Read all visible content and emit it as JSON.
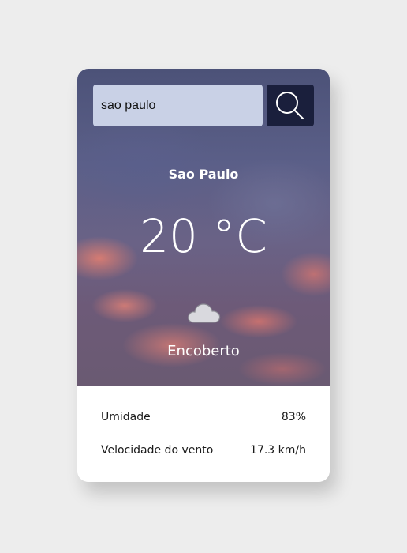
{
  "search": {
    "value": "sao paulo",
    "icon": "search-icon"
  },
  "weather": {
    "city": "Sao Paulo",
    "temperature": "20 °C",
    "condition": "Encoberto",
    "icon": "cloud-icon"
  },
  "details": {
    "humidity_label": "Umidade",
    "humidity_value": "83%",
    "wind_label": "Velocidade do vento",
    "wind_value": "17.3 km/h"
  },
  "colors": {
    "page_background": "#ededed",
    "search_input_background": "#c9d1e6",
    "search_button_background": "#1a1f3c",
    "details_background": "#ffffff"
  }
}
